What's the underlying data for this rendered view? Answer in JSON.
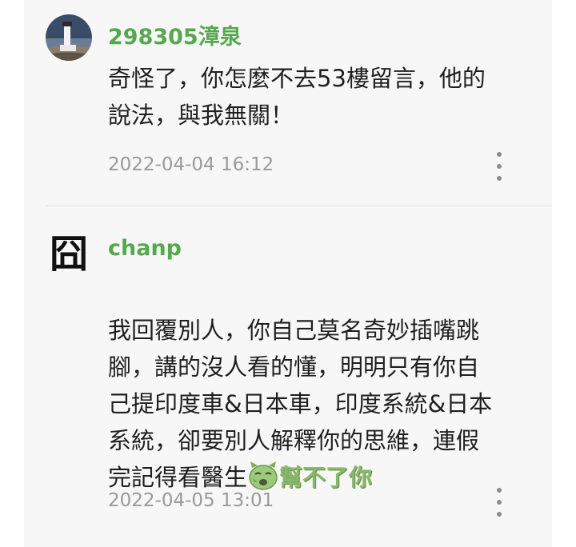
{
  "comments": [
    {
      "author": "298305漳泉",
      "text": "奇怪了，你怎麼不去53樓留言，他的\n說法，與我無關！",
      "timestamp": "2022-04-04 16:12",
      "avatar": "lighthouse-photo"
    },
    {
      "author": "chanp",
      "text": "我回覆別人，你自己莫名奇妙插嘴跳\n腳，講的沒人看的懂，明明只有你自\n己提印度車&日本車，印度系統&日本\n系統，卻要別人解釋你的思維，連假\n完記得看醫生",
      "sticker_text": "幫不了你",
      "timestamp": "2022-04-05 13:01",
      "avatar_glyph": "囧"
    }
  ],
  "icons": {
    "more": "more-vertical-icon",
    "sticker": "sick-face-sticker-icon"
  },
  "colors": {
    "author": "#55a84d",
    "timestamp": "#9a9a9a",
    "panel_background": "#f7f7f7"
  }
}
